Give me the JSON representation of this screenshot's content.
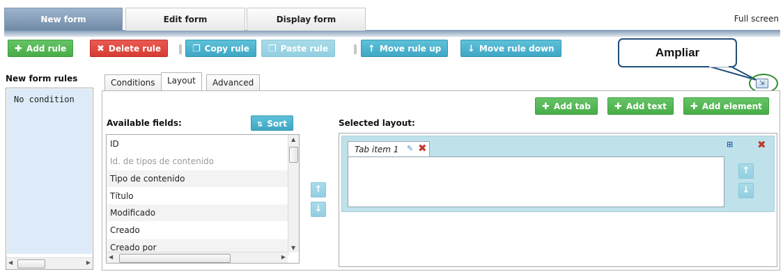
{
  "tabs": [
    {
      "label": "New form",
      "active": true
    },
    {
      "label": "Edit form",
      "active": false
    },
    {
      "label": "Display form",
      "active": false
    }
  ],
  "full_screen_label": "Full screen",
  "toolbar": {
    "add_rule": "Add rule",
    "delete_rule": "Delete rule",
    "copy_rule": "Copy rule",
    "paste_rule": "Paste rule",
    "move_rule_up": "Move rule up",
    "move_rule_down": "Move rule down"
  },
  "callout": {
    "text": "Ampliar"
  },
  "rules_panel": {
    "title": "New form rules",
    "items": [
      "No condition"
    ]
  },
  "inner_tabs": [
    {
      "label": "Conditions",
      "active": false
    },
    {
      "label": "Layout",
      "active": true
    },
    {
      "label": "Advanced",
      "active": false
    }
  ],
  "layout_actions": {
    "add_tab": "Add tab",
    "add_text": "Add text",
    "add_element": "Add element"
  },
  "available_fields": {
    "label": "Available fields:",
    "sort_label": "Sort",
    "items": [
      {
        "text": "ID",
        "dim": false
      },
      {
        "text": "Id. de tipos de contenido",
        "dim": true
      },
      {
        "text": "Tipo de contenido",
        "dim": false
      },
      {
        "text": "Título",
        "dim": false
      },
      {
        "text": "Modificado",
        "dim": false
      },
      {
        "text": "Creado",
        "dim": false
      },
      {
        "text": "Creado por",
        "dim": false
      }
    ]
  },
  "selected_layout": {
    "label": "Selected layout:",
    "tab_item": "Tab item 1"
  },
  "colors": {
    "green": "#48ad48",
    "red": "#d63c34",
    "blue": "#3ea7c4",
    "tab_active": "#6f8aa6",
    "callout_border": "#1f4e79",
    "highlight_green": "#2e8b2e"
  },
  "icons": [
    "plus-icon",
    "x-icon",
    "copy-icon",
    "paste-icon",
    "arrow-up-icon",
    "arrow-down-icon",
    "sort-az-icon",
    "pencil-icon",
    "add-tab-icon",
    "expand-icon"
  ]
}
